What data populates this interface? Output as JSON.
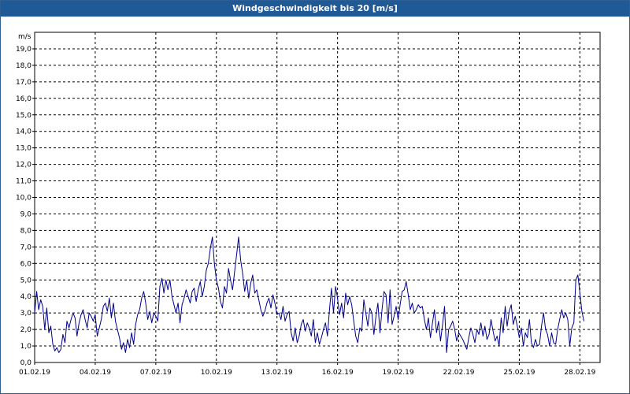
{
  "window": {
    "title": "Windgeschwindigkeit bis 20 [m/s]"
  },
  "chart_data": {
    "type": "line",
    "title": "Windgeschwindigkeit bis 20 [m/s]",
    "ylabel": "m/s",
    "xlabel": "",
    "ylim": [
      0,
      20
    ],
    "xlim": [
      "01.02.19 00:00",
      "01.03.19 00:00"
    ],
    "grid": true,
    "color": "#00008b",
    "y_ticks": [
      "1,0",
      "2,0",
      "3,0",
      "4,0",
      "5,0",
      "6,0",
      "7,0",
      "8,0",
      "9,0",
      "10,0",
      "11,0",
      "12,0",
      "13,0",
      "14,0",
      "15,0",
      "16,0",
      "17,0",
      "18,0",
      "19,0"
    ],
    "x_ticks": [
      "01.02.19",
      "04.02.19",
      "07.02.19",
      "10.02.19",
      "13.02.19",
      "16.02.19",
      "19.02.19",
      "22.02.19",
      "25.02.19",
      "28.02.19"
    ],
    "x": [
      0,
      0.1,
      0.2,
      0.3,
      0.4,
      0.5,
      0.6,
      0.7,
      0.8,
      0.9,
      1.0,
      1.1,
      1.2,
      1.3,
      1.4,
      1.5,
      1.6,
      1.7,
      1.8,
      1.9,
      2.0,
      2.1,
      2.2,
      2.3,
      2.4,
      2.5,
      2.6,
      2.7,
      2.8,
      2.9,
      3.0,
      3.1,
      3.2,
      3.3,
      3.4,
      3.5,
      3.6,
      3.7,
      3.8,
      3.9,
      4.0,
      4.1,
      4.2,
      4.3,
      4.4,
      4.5,
      4.6,
      4.7,
      4.8,
      4.9,
      5.0,
      5.1,
      5.2,
      5.3,
      5.4,
      5.5,
      5.6,
      5.7,
      5.8,
      5.9,
      6.0,
      6.1,
      6.2,
      6.3,
      6.4,
      6.5,
      6.6,
      6.7,
      6.8,
      6.9,
      7.0,
      7.1,
      7.2,
      7.3,
      7.4,
      7.5,
      7.6,
      7.7,
      7.8,
      7.9,
      8.0,
      8.1,
      8.2,
      8.3,
      8.4,
      8.5,
      8.6,
      8.7,
      8.8,
      8.9,
      9.0,
      9.1,
      9.2,
      9.3,
      9.4,
      9.5,
      9.6,
      9.7,
      9.8,
      9.9,
      10.0,
      10.1,
      10.2,
      10.3,
      10.4,
      10.5,
      10.6,
      10.7,
      10.8,
      10.9,
      11.0,
      11.1,
      11.2,
      11.3,
      11.4,
      11.5,
      11.6,
      11.7,
      11.8,
      11.9,
      12.0,
      12.1,
      12.2,
      12.3,
      12.4,
      12.5,
      12.6,
      12.7,
      12.8,
      12.9,
      13.0,
      13.1,
      13.2,
      13.3,
      13.4,
      13.5,
      13.6,
      13.7,
      13.8,
      13.9,
      14.0,
      14.1,
      14.2,
      14.3,
      14.4,
      14.5,
      14.6,
      14.7,
      14.8,
      14.9,
      15.0,
      15.1,
      15.2,
      15.3,
      15.4,
      15.5,
      15.6,
      15.7,
      15.8,
      15.9,
      16.0,
      16.1,
      16.2,
      16.3,
      16.4,
      16.5,
      16.6,
      16.7,
      16.8,
      16.9,
      17.0,
      17.1,
      17.2,
      17.3,
      17.4,
      17.5,
      17.6,
      17.7,
      17.8,
      17.9,
      18.0,
      18.1,
      18.2,
      18.3,
      18.4,
      18.5,
      18.6,
      18.7,
      18.8,
      18.9,
      19.0,
      19.1,
      19.2,
      19.3,
      19.4,
      19.5,
      19.6,
      19.7,
      19.8,
      19.9,
      20.0,
      20.1,
      20.2,
      20.3,
      20.4,
      20.5,
      20.6,
      20.7,
      20.8,
      20.9,
      21.0,
      21.1,
      21.2,
      21.3,
      21.4,
      21.5,
      21.6,
      21.7,
      21.8,
      21.9,
      22.0,
      22.1,
      22.2,
      22.3,
      22.4,
      22.5,
      22.6,
      22.7,
      22.8,
      22.9,
      23.0,
      23.1,
      23.2,
      23.3,
      23.4,
      23.5,
      23.6,
      23.7,
      23.8,
      23.9,
      24.0,
      24.1,
      24.2,
      24.3,
      24.4,
      24.5,
      24.6,
      24.7,
      24.8,
      24.9,
      25.0,
      25.1,
      25.2,
      25.3,
      25.4,
      25.5,
      25.6,
      25.7,
      25.8,
      25.9,
      26.0,
      26.1,
      26.2,
      26.3,
      26.4,
      26.5,
      26.6,
      26.7,
      26.8,
      26.9,
      27.0,
      27.1,
      27.2,
      27.3,
      27.4,
      27.5,
      27.6,
      27.7,
      27.8,
      27.9,
      28.0,
      28.1,
      28.2,
      28.3,
      28.4,
      28.5,
      28.6,
      28.7,
      28.8,
      28.9
    ],
    "series": [
      {
        "values": [
          3.0,
          4.3,
          3.2,
          3.8,
          3.4,
          2.0,
          3.3,
          1.8,
          2.2,
          1.1,
          0.7,
          0.9,
          0.6,
          0.8,
          1.7,
          1.2,
          2.5,
          2.1,
          2.6,
          3.0,
          2.7,
          1.6,
          2.4,
          2.9,
          3.2,
          2.6,
          2.1,
          3.0,
          2.8,
          2.5,
          2.9,
          1.6,
          2.1,
          2.6,
          3.4,
          3.6,
          3.1,
          3.9,
          2.7,
          3.6,
          2.5,
          2.0,
          1.5,
          0.8,
          1.2,
          0.6,
          1.4,
          0.9,
          1.8,
          1.1,
          2.3,
          2.9,
          3.2,
          3.9,
          4.3,
          3.6,
          2.6,
          3.1,
          2.4,
          3.0,
          2.8,
          2.5,
          4.6,
          5.1,
          4.2,
          5.0,
          4.4,
          5.0,
          4.0,
          3.5,
          3.0,
          3.6,
          2.4,
          3.5,
          3.9,
          4.4,
          4.0,
          3.6,
          4.3,
          4.5,
          3.7,
          4.4,
          4.9,
          4.0,
          4.6,
          5.6,
          6.0,
          6.9,
          7.6,
          6.0,
          5.0,
          4.5,
          3.7,
          3.3,
          4.6,
          4.2,
          5.7,
          5.0,
          4.4,
          5.5,
          6.5,
          7.6,
          6.2,
          5.4,
          4.3,
          5.0,
          3.9,
          4.8,
          5.3,
          4.2,
          4.4,
          3.8,
          3.2,
          2.8,
          3.1,
          3.6,
          3.9,
          3.3,
          4.1,
          3.6,
          2.9,
          3.0,
          2.6,
          3.4,
          2.5,
          2.9,
          3.1,
          1.8,
          1.3,
          2.1,
          1.2,
          1.6,
          2.3,
          2.6,
          1.9,
          2.4,
          2.1,
          1.6,
          2.6,
          1.2,
          1.8,
          1.1,
          1.5,
          2.0,
          2.4,
          1.6,
          3.2,
          4.5,
          3.0,
          4.6,
          3.9,
          2.9,
          3.6,
          2.7,
          4.2,
          3.5,
          4.0,
          3.5,
          2.5,
          1.6,
          1.2,
          2.1,
          1.9,
          3.8,
          3.0,
          2.2,
          3.3,
          3.0,
          1.7,
          2.8,
          3.6,
          1.8,
          3.2,
          4.3,
          4.1,
          2.4,
          4.4,
          2.3,
          2.8,
          3.4,
          2.6,
          3.5,
          4.3,
          4.4,
          4.9,
          4.1,
          3.2,
          3.6,
          3.0,
          3.2,
          3.5,
          3.3,
          3.4,
          2.6,
          2.0,
          2.7,
          1.5,
          2.4,
          3.2,
          1.8,
          2.5,
          1.3,
          2.3,
          3.4,
          0.6,
          2.0,
          2.2,
          2.5,
          2.0,
          1.3,
          1.8,
          1.6,
          1.4,
          1.1,
          0.8,
          1.5,
          2.1,
          1.7,
          1.2,
          2.0,
          1.7,
          2.4,
          1.6,
          2.2,
          1.4,
          1.7,
          2.6,
          1.9,
          1.3,
          1.6,
          1.0,
          2.7,
          1.8,
          3.4,
          2.2,
          3.1,
          3.5,
          2.3,
          2.8,
          2.2,
          1.5,
          2.1,
          1.0,
          1.8,
          1.5,
          2.6,
          1.2,
          0.9,
          1.4,
          1.0,
          1.1,
          2.2,
          3.0,
          2.0,
          1.7,
          1.0,
          1.8,
          1.2,
          1.1,
          2.0,
          2.6,
          3.2,
          2.7,
          3.0,
          2.6,
          1.0,
          2.1,
          2.4,
          5.0,
          5.3,
          4.2,
          3.1,
          2.5
        ]
      }
    ]
  }
}
